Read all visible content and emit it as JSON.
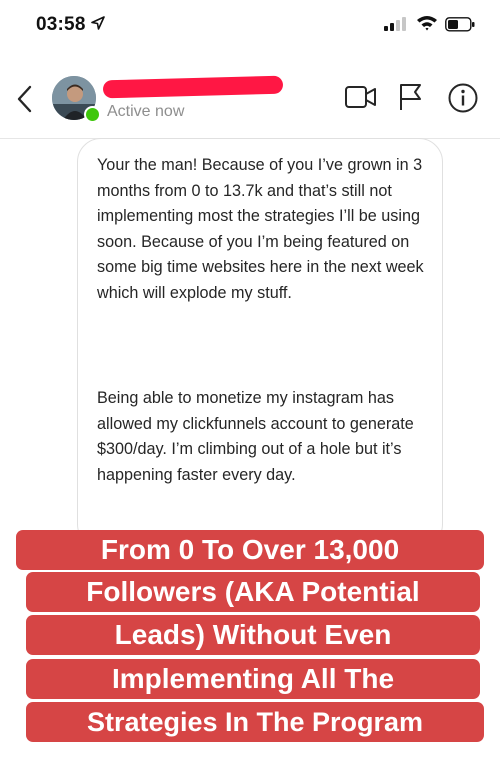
{
  "status_bar": {
    "time": "03:58",
    "location_icon": "location-arrow-icon",
    "signal_icon": "cellular-signal-icon",
    "wifi_icon": "wifi-icon",
    "battery_icon": "battery-icon"
  },
  "header": {
    "back_icon": "chevron-left-icon",
    "active_status": "Active now",
    "video_icon": "video-camera-icon",
    "flag_icon": "flag-icon",
    "info_icon": "info-icon",
    "active_color": "#3ec70b",
    "redaction_color": "#ff1744"
  },
  "message": {
    "paragraph_1": "Your the man! Because of you I’ve grown in 3 months from 0 to 13.7k and that’s still not implementing most the strategies I’ll be using soon. Because of you I’m being featured on some big time websites here in the next week which will explode my stuff.",
    "paragraph_2": "Being able to monetize my instagram has allowed my clickfunnels account to generate $300/day. I’m climbing out of a hole but it’s happening faster every day."
  },
  "caption": {
    "line_1": "From 0 To Over 13,000",
    "line_2": "Followers (AKA Potential",
    "line_3": "Leads) Without Even",
    "line_4": "Implementing All The",
    "line_5": "Strategies In The Program",
    "background_color": "#d64545"
  }
}
